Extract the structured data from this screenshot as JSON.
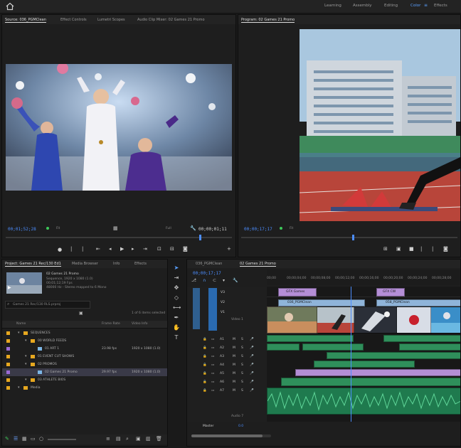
{
  "workspaces": [
    "Learning",
    "Assembly",
    "Editing",
    "Color",
    "Effects"
  ],
  "active_workspace": "Color",
  "source": {
    "tabs": [
      "Source: 036_PGMClean",
      "Effect Controls",
      "Lumetri Scopes",
      "Audio Clip Mixer: 02 Games 21 Promo"
    ],
    "timecode_in": "00;01;52;28",
    "fit": "Fit",
    "quality": "Full",
    "timecode_dur": "00;00;01;11"
  },
  "program": {
    "tab": "Program: 02 Games 21 Promo",
    "timecode": "00;00;17;17",
    "fit": "Fit"
  },
  "project": {
    "tabs": [
      "Project: Games 21 Rec/130 Ed1",
      "Media Browser",
      "Info",
      "Effects"
    ],
    "seq_name": "02 Games 21 Promo",
    "seq_info": [
      "Sequence, 1920 x 1080 (1.0)",
      "00;01;12;19 Fps",
      "48000 Hz - Stereo mapped to 6 Mono"
    ],
    "search_path": "Games 21 Rec/130 RLS.prproj",
    "item_count": "1 of 6 items selected",
    "col_name": "Name",
    "col_fps": "Frame Rate",
    "col_info": "Video Info",
    "rows": [
      {
        "name": "SEQUENCES",
        "fps": "",
        "info": "",
        "indent": 0,
        "type": "folder"
      },
      {
        "name": "00 WORLD FEEDS",
        "fps": "",
        "info": "",
        "indent": 1,
        "type": "folder"
      },
      {
        "name": "01 ART 1",
        "fps": "23.98 fps",
        "info": "1920 x 1080 (1.0)",
        "indent": 2,
        "type": "seq"
      },
      {
        "name": "01 EVENT CUT SHOWS",
        "fps": "",
        "info": "",
        "indent": 1,
        "type": "folder"
      },
      {
        "name": "02 PROMOS",
        "fps": "",
        "info": "",
        "indent": 1,
        "type": "folder"
      },
      {
        "name": "02 Games 21 Promo",
        "fps": "29.97 fps",
        "info": "1920 x 1080 (1.0)",
        "indent": 2,
        "type": "seq",
        "selected": true
      },
      {
        "name": "03 ATHLETE BIOS",
        "fps": "",
        "info": "",
        "indent": 1,
        "type": "folder"
      },
      {
        "name": "Media",
        "fps": "",
        "info": "",
        "indent": 0,
        "type": "folder"
      }
    ]
  },
  "timeline": {
    "tabs": [
      "036_PGMClean",
      "02 Games 21 Promo"
    ],
    "timecode": "00;00;17;17",
    "ruler": [
      "00;00",
      "00;00;04;00",
      "00;00;08;00",
      "00;00;12;00",
      "00;00;16;00",
      "00;00;20;00",
      "00;00;24;00",
      "00;00;28;00"
    ],
    "tracks": [
      "V3",
      "V2",
      "V1",
      "A1",
      "A2",
      "A3",
      "A4",
      "A5",
      "A6",
      "A7"
    ],
    "v1_label": "Video 1",
    "a7_label": "Audio 7",
    "master": "Master",
    "master_val": "0.0",
    "clip_labels": [
      "GFX Games",
      "GFX CW",
      "036_PGMClean",
      "058_PGMClean",
      "036_PGMClean"
    ]
  },
  "colors": {
    "accent_blue": "#4c8dff",
    "folder": "#e6a71f",
    "clip_video": "#8fb4d9",
    "clip_audio": "#2f8f5b",
    "clip_gfx": "#b48ed6"
  }
}
